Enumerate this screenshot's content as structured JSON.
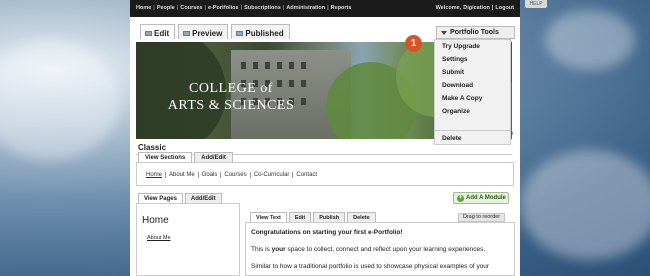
{
  "topbar": {
    "nav": [
      "Home",
      "People",
      "Courses",
      "e-Portfolios",
      "Subscriptions",
      "Administration",
      "Reports"
    ],
    "welcome_prefix": "Welcome,",
    "user": "Digication",
    "logout": "Logout",
    "help": "HELP"
  },
  "tabs": {
    "edit": "Edit",
    "preview": "Preview",
    "published": "Published"
  },
  "banner": {
    "line1": "COLLEGE of",
    "line2": "ARTS & SCIENCES"
  },
  "portfolio_tools": {
    "label": "Portfolio Tools",
    "items": [
      "Try Upgrade",
      "Settings",
      "Submit",
      "Download",
      "Make A Copy",
      "Organize"
    ],
    "delete": "Delete"
  },
  "badge": "1",
  "theme_title": "Classic",
  "partial_text": "e",
  "section_tabs": [
    "View Sections",
    "Add/Edit"
  ],
  "sections": [
    "Home",
    "About Me",
    "Goals",
    "Courses",
    "Co-Curricular",
    "Contact"
  ],
  "add_module": "Add A Module",
  "page_tabs": [
    "View Pages",
    "Add/Edit"
  ],
  "pages": {
    "heading": "Home",
    "items": [
      "About Me"
    ]
  },
  "view_tabs": [
    "View Text",
    "Edit",
    "Publish",
    "Delete"
  ],
  "drag_to_reorder": "Drag to reorder",
  "content": {
    "heading": "Congratulations on starting your first e-Portfolio!",
    "p1_pre": "This is ",
    "p1_bold": "your",
    "p1_post": " space to collect, connect and reflect upon your learning experiences.",
    "p2": "Similar to how a traditional portfolio is used to showcase physical examples of your"
  }
}
